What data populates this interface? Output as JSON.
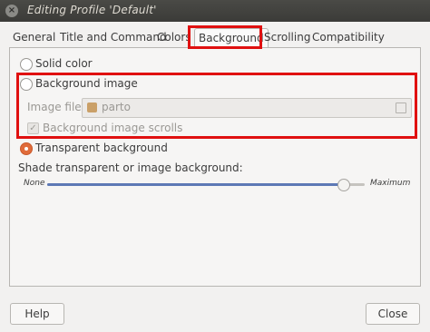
{
  "window": {
    "title": "Editing Profile 'Default'",
    "close_glyph": "×"
  },
  "tabs": [
    {
      "label": "General"
    },
    {
      "label": "Title and Command"
    },
    {
      "label": "Colors"
    },
    {
      "label": "Background",
      "active": true
    },
    {
      "label": "Scrolling"
    },
    {
      "label": "Compatibility"
    }
  ],
  "background": {
    "solid_color_label": "Solid color",
    "background_image_label": "Background image",
    "image_file_label": "Image file:",
    "image_file_value": "parto",
    "image_scrolls_label": "Background image scrolls",
    "image_scrolls_checked": true,
    "transparent_label": "Transparent background",
    "selected_option": "transparent",
    "shade_label": "Shade transparent or image background:",
    "shade_min_label": "None",
    "shade_max_label": "Maximum",
    "shade_value_fraction": 0.93
  },
  "buttons": {
    "help": "Help",
    "close": "Close"
  },
  "colors": {
    "accent": "#e06b3a",
    "highlight": "#e01010",
    "slider": "#5d79b5"
  }
}
